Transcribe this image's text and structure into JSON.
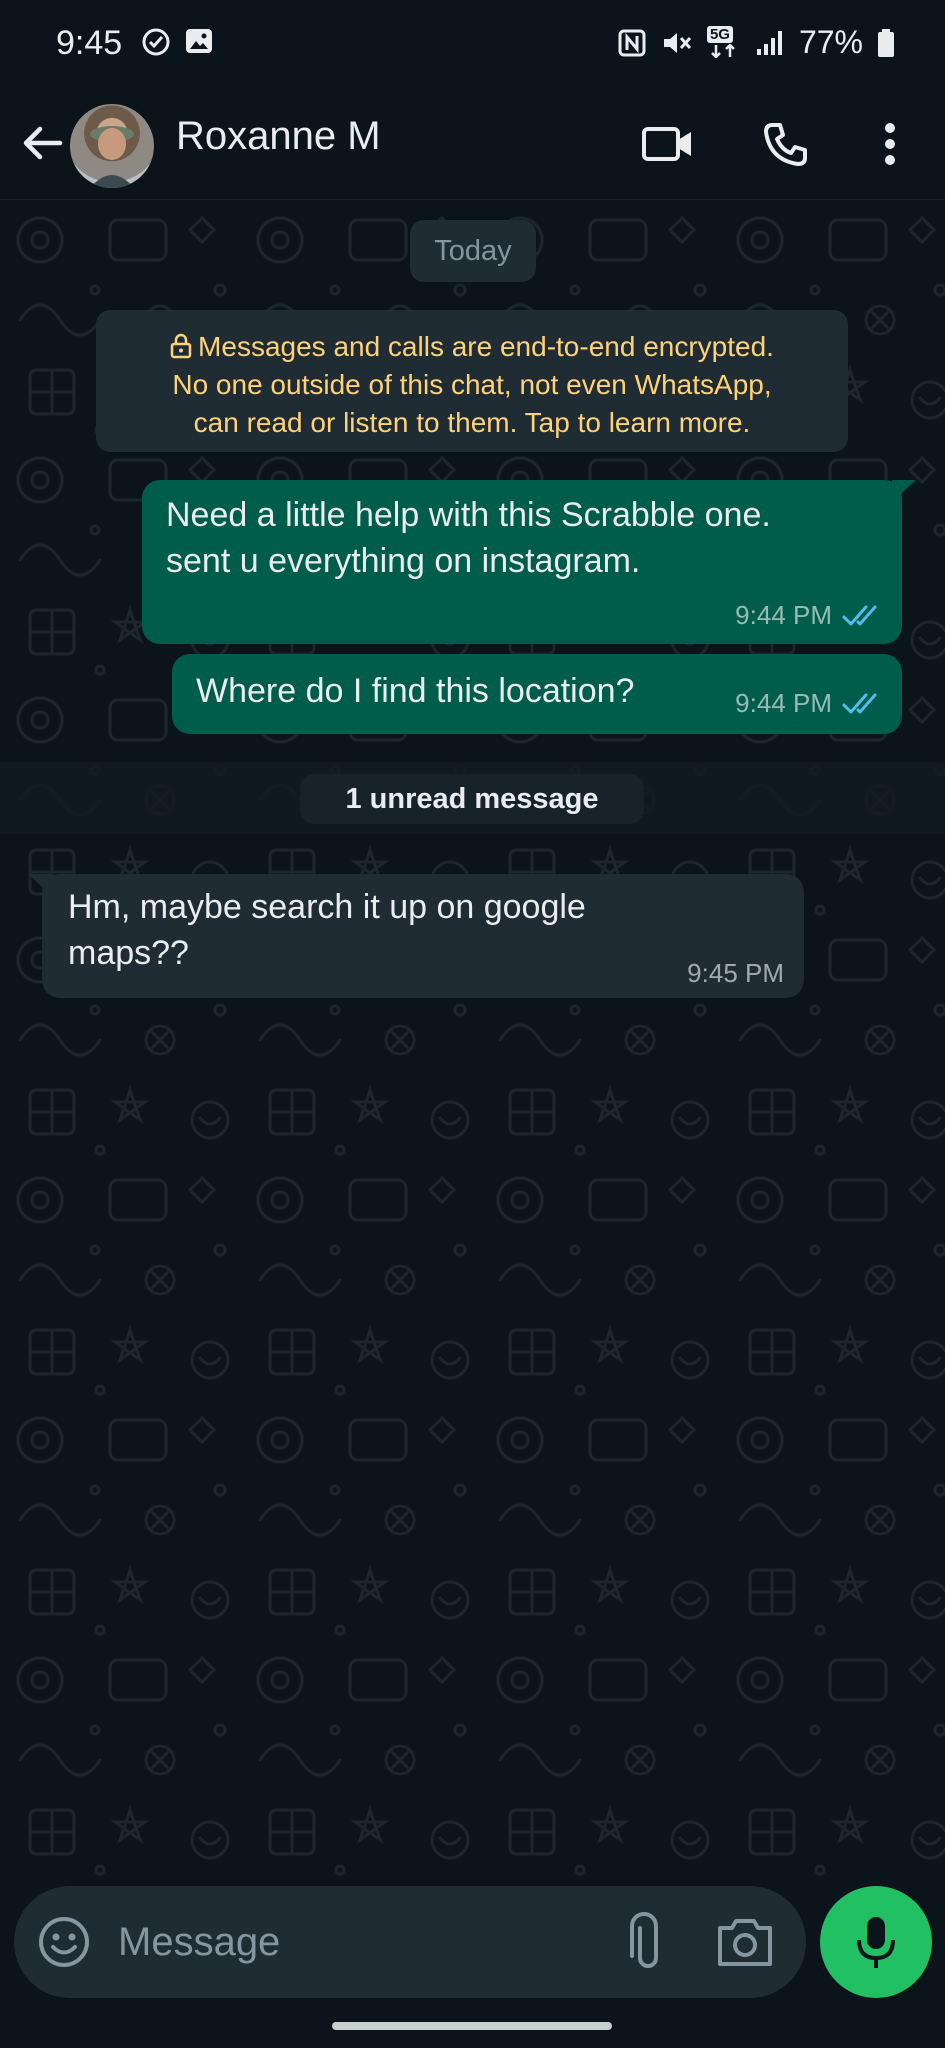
{
  "status_bar": {
    "time": "9:45",
    "network": "5G",
    "battery": "77%",
    "icons": [
      "check-circle-icon",
      "gallery-icon",
      "nfc-icon",
      "mute-icon",
      "5g-icon",
      "signal-icon",
      "battery-icon"
    ]
  },
  "header": {
    "contact_name": "Roxanne M",
    "icons": [
      "back-arrow-icon",
      "video-call-icon",
      "voice-call-icon",
      "more-options-icon"
    ]
  },
  "chat": {
    "date_chip": "Today",
    "encryption_notice": "Messages and calls are end-to-end encrypted. No one outside of this chat, not even WhatsApp, can read or listen to them. Tap to learn more.",
    "encryption_lines": [
      "Messages and calls are end-to-end encrypted.",
      "No one outside of this chat, not even WhatsApp,",
      "can read or listen to them. Tap to learn more."
    ],
    "messages": [
      {
        "direction": "outgoing",
        "lines": [
          "Need a little help with this Scrabble one.",
          "sent u everything on instagram."
        ],
        "time": "9:44 PM",
        "status": "read"
      },
      {
        "direction": "outgoing",
        "lines": [
          "Where do I find this location?"
        ],
        "time": "9:44 PM",
        "status": "read"
      },
      {
        "direction": "incoming",
        "lines": [
          "Hm, maybe search it up on google",
          "maps??"
        ],
        "time": "9:45 PM"
      }
    ],
    "unread_label": "1 unread message"
  },
  "composer": {
    "placeholder": "Message",
    "icons": [
      "emoji-icon",
      "attach-icon",
      "camera-icon",
      "mic-icon"
    ]
  },
  "colors": {
    "background": "#0b141a",
    "outgoing_bubble": "#005c4b",
    "incoming_bubble": "#1f2c34",
    "encryption_text": "#ffd279",
    "read_ticks": "#53bdeb",
    "mic_button": "#21c063"
  }
}
